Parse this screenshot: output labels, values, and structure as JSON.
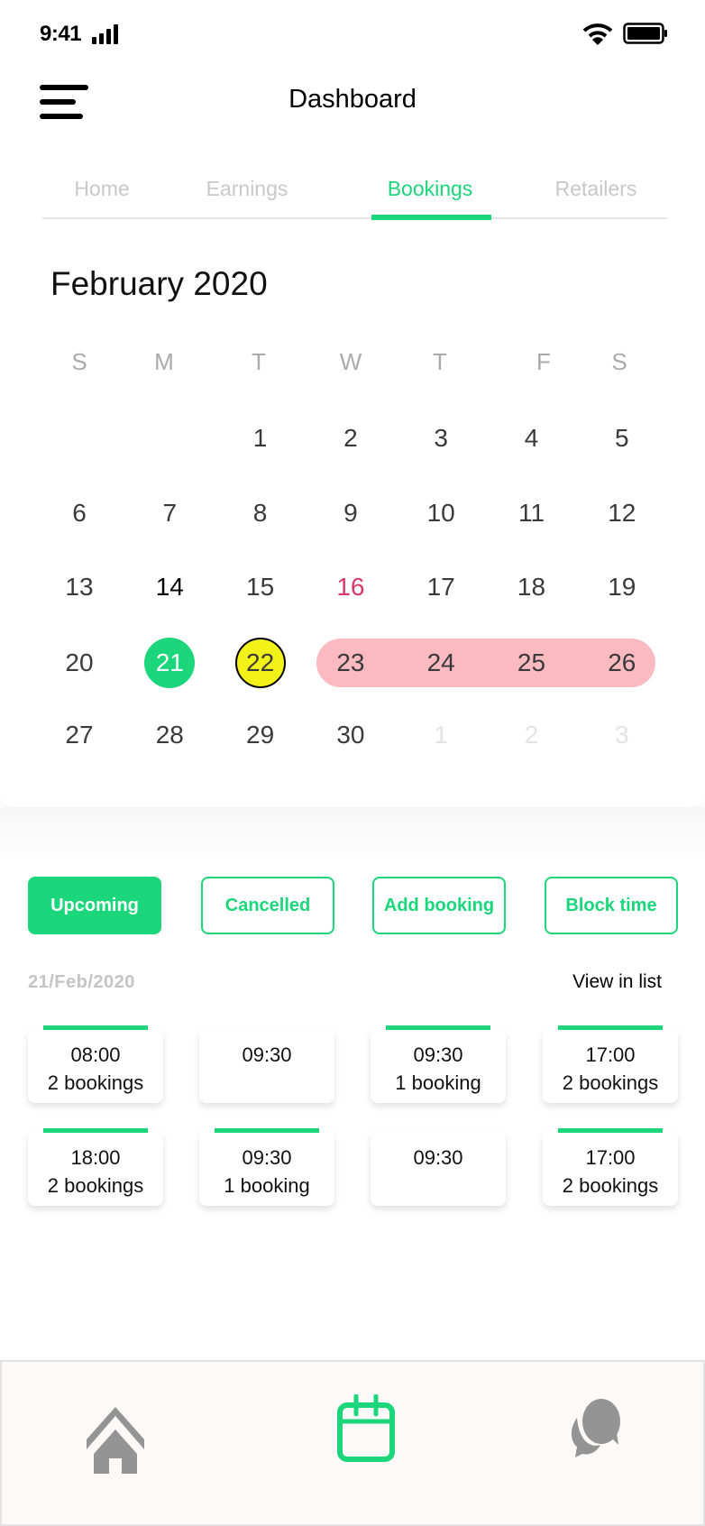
{
  "status_bar": {
    "time": "9:41",
    "icons": [
      "signal-icon",
      "wifi-icon",
      "battery-icon"
    ]
  },
  "header": {
    "title": "Dashboard",
    "menu_icon": "hamburger-menu-icon"
  },
  "tabs": [
    {
      "label": "Home",
      "active": false
    },
    {
      "label": "Earnings",
      "active": false
    },
    {
      "label": "Bookings",
      "active": true
    },
    {
      "label": "Retailers",
      "active": false
    }
  ],
  "calendar": {
    "month_title": "February 2020",
    "weekdays": [
      "S",
      "M",
      "T",
      "W",
      "T",
      "F",
      "S"
    ],
    "weeks": [
      [
        null,
        null,
        null,
        {
          "d": "1"
        },
        {
          "d": "2"
        },
        {
          "d": "3"
        },
        {
          "d": "4"
        },
        {
          "d": "5"
        }
      ],
      [
        {
          "d": "6"
        },
        {
          "d": "7"
        },
        {
          "d": "8"
        },
        {
          "d": "9"
        },
        {
          "d": "10"
        },
        {
          "d": "11"
        },
        {
          "d": "12"
        }
      ],
      [
        {
          "d": "13"
        },
        {
          "d": "14",
          "s": "black"
        },
        {
          "d": "15"
        },
        {
          "d": "16",
          "s": "red"
        },
        {
          "d": "17"
        },
        {
          "d": "18"
        },
        {
          "d": "19"
        }
      ],
      [
        {
          "d": "20"
        },
        {
          "d": "21",
          "s": "today"
        },
        {
          "d": "22",
          "s": "sel"
        },
        {
          "d": "23"
        },
        {
          "d": "24"
        },
        {
          "d": "25"
        },
        {
          "d": "26"
        }
      ],
      [
        {
          "d": "27"
        },
        {
          "d": "28"
        },
        {
          "d": "29"
        },
        {
          "d": "30"
        },
        {
          "d": "1",
          "s": "muted"
        },
        {
          "d": "2",
          "s": "muted"
        },
        {
          "d": "3",
          "s": "muted"
        }
      ]
    ],
    "highlighted_range": [
      "23",
      "26"
    ]
  },
  "filters": [
    {
      "label": "Upcoming",
      "active": true
    },
    {
      "label": "Cancelled",
      "active": false
    },
    {
      "label": "Add booking",
      "active": false
    },
    {
      "label": "Block time",
      "active": false
    }
  ],
  "date_label": "21/Feb/2020",
  "view_in_list": "View in list",
  "slots": [
    {
      "time": "08:00",
      "count": "2 bookings",
      "booked": true
    },
    {
      "time": "09:30",
      "count": "",
      "booked": false
    },
    {
      "time": "09:30",
      "count": "1 booking",
      "booked": true
    },
    {
      "time": "17:00",
      "count": "2 bookings",
      "booked": true
    },
    {
      "time": "18:00",
      "count": "2 bookings",
      "booked": true
    },
    {
      "time": "09:30",
      "count": "1 booking",
      "booked": true
    },
    {
      "time": "09:30",
      "count": "",
      "booked": false
    },
    {
      "time": "17:00",
      "count": "2 bookings",
      "booked": true
    }
  ],
  "bottom_nav": [
    {
      "icon": "home-icon",
      "active": false
    },
    {
      "icon": "calendar-icon",
      "active": true
    },
    {
      "icon": "chat-icon",
      "active": false
    }
  ],
  "colors": {
    "accent": "#1bd67a",
    "range": "#fbb9c0",
    "selected": "#f2f21a",
    "holiday": "#d8386a"
  }
}
